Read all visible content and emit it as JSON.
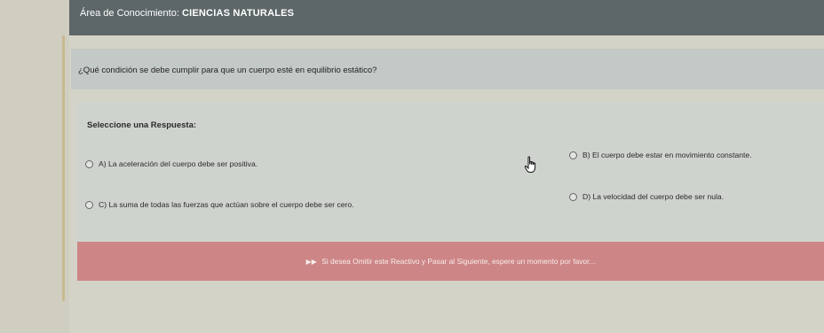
{
  "header": {
    "area_label": "Área de Conocimiento:",
    "area_value": "CIENCIAS NATURALES"
  },
  "question": {
    "text": "¿Qué condición se debe cumplir para que un cuerpo esté en equilibrio estático?"
  },
  "answers": {
    "title": "Seleccione una Respuesta:",
    "options": [
      {
        "label": "A) La aceleración del cuerpo debe ser positiva."
      },
      {
        "label": "B) El cuerpo debe estar en movimiento constante."
      },
      {
        "label": "C) La suma de todas las fuerzas que actúan sobre el cuerpo debe ser cero."
      },
      {
        "label": "D) La velocidad del cuerpo debe ser nula."
      }
    ]
  },
  "skip": {
    "icon": "fast-forward-icon",
    "label": "Si desea Omitir este Reactivo y Pasar al Siguiente, espere un momento por favor..."
  },
  "colors": {
    "header_bg": "#5d6668",
    "skip_bg": "#cd8585"
  }
}
